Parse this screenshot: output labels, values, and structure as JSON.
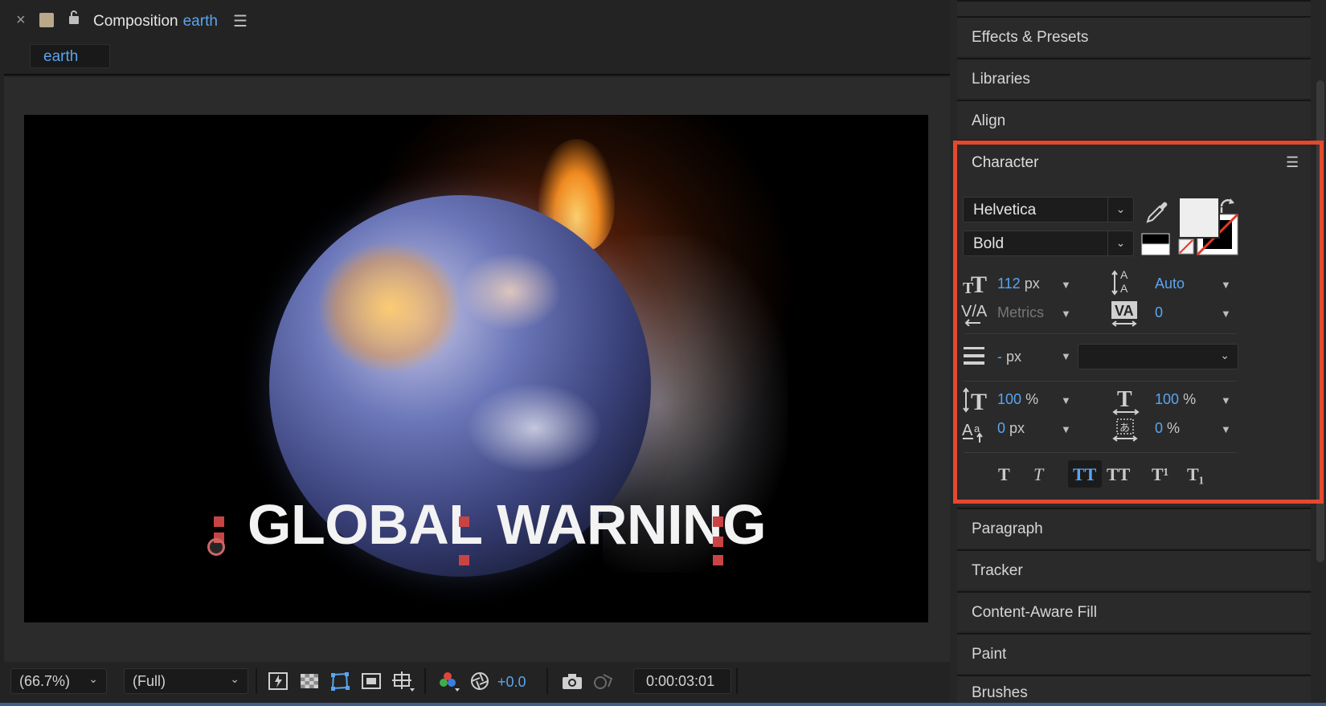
{
  "comp_panel": {
    "close_glyph": "×",
    "title_prefix": "Composition",
    "title_name": "earth",
    "menu_glyph": "☰",
    "tab_label": "earth",
    "overlay_text": "GLOBAL WARNING",
    "zoom": "(66.7%)",
    "resolution": "(Full)",
    "exposure": "+0.0",
    "timecode": "0:00:03:01"
  },
  "right_panel": {
    "sections_top": [
      "Effects & Presets",
      "Libraries",
      "Align"
    ],
    "sections_bottom": [
      "Paragraph",
      "Tracker",
      "Content-Aware Fill",
      "Paint",
      "Brushes"
    ]
  },
  "character": {
    "title": "Character",
    "menu_glyph": "☰",
    "font_family": "Helvetica",
    "font_style": "Bold",
    "font_size_value": "112",
    "font_size_unit": "px",
    "leading": "Auto",
    "kerning": "Metrics",
    "tracking": "0",
    "stroke_value": "-",
    "stroke_unit": "px",
    "vertical_scale_value": "100",
    "vertical_scale_unit": "%",
    "horizontal_scale_value": "100",
    "horizontal_scale_unit": "%",
    "baseline_shift_value": "0",
    "baseline_shift_unit": "px",
    "tsume_value": "0",
    "tsume_unit": "%",
    "styles": [
      "T",
      "T",
      "TT",
      "TT",
      "T¹",
      "T₁"
    ],
    "fill_color": "#eeeeee",
    "highlight_color": "#e5482e",
    "accent_color": "#5aa5f0"
  }
}
